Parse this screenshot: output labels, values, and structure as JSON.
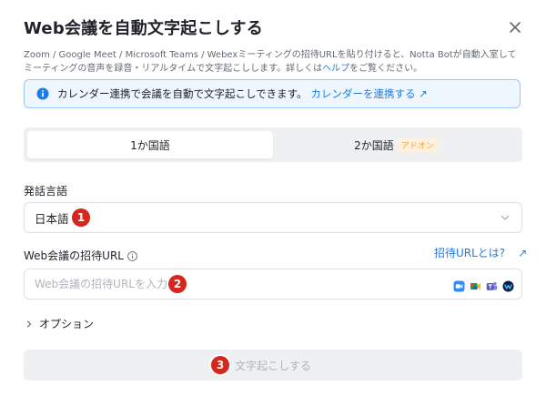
{
  "dialog": {
    "title": "Web会議を自動文字起こしする",
    "description_prefix": "Zoom / Google Meet / Microsoft Teams / Webexミーティングの招待URLを貼り付けると、Notta Botが自動入室してミーティングの音声を録音・リアルタイムで文字起こしします。詳しくは",
    "description_link": "ヘルプ",
    "description_suffix": "をご覧ください。"
  },
  "banner": {
    "text": "カレンダー連携で会議を自動で文字起こしできます。",
    "link": "カレンダーを連携する ↗"
  },
  "tabs": [
    {
      "label": "1か国語",
      "active": true
    },
    {
      "label": "2か国語",
      "badge": "アドオン",
      "active": false
    }
  ],
  "language": {
    "label": "発話言語",
    "value": "日本語"
  },
  "url_field": {
    "label": "Web会議の招待URL",
    "help_link": "招待URLとは?",
    "help_link_arrow": "↗",
    "placeholder": "Web会議の招待URLを入力",
    "value": ""
  },
  "options": {
    "label": "オプション"
  },
  "submit": {
    "label": "文字起こしする"
  },
  "markers": [
    "1",
    "2",
    "3"
  ],
  "colors": {
    "link": "#1e7ce8",
    "marker": "#d7261b",
    "banner_bg": "#eef6fe",
    "addon_badge": "#f5a13a"
  },
  "icons": [
    "close-icon",
    "info-icon",
    "chevron-down-icon",
    "help-circle-icon",
    "external-link-icon",
    "zoom-icon",
    "google-meet-icon",
    "microsoft-teams-icon",
    "webex-icon",
    "chevron-right-icon"
  ]
}
